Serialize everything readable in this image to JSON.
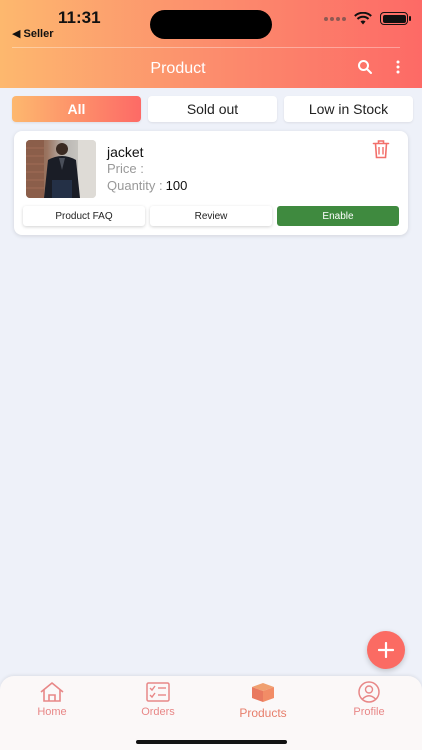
{
  "status": {
    "time": "11:31",
    "back_label": "◀ Seller"
  },
  "header": {
    "title": "Product"
  },
  "tabs": [
    {
      "label": "All",
      "active": true
    },
    {
      "label": "Sold out",
      "active": false
    },
    {
      "label": "Low in Stock",
      "active": false
    }
  ],
  "product": {
    "name": "jacket",
    "price_label": "Price :",
    "quantity_label": "Quantity :",
    "quantity_value": "100",
    "buttons": {
      "faq": "Product FAQ",
      "review": "Review",
      "enable": "Enable"
    }
  },
  "bottom_nav": [
    {
      "label": "Home",
      "icon": "home-icon"
    },
    {
      "label": "Orders",
      "icon": "orders-icon"
    },
    {
      "label": "Products",
      "icon": "products-icon",
      "active": true
    },
    {
      "label": "Profile",
      "icon": "profile-icon"
    }
  ],
  "colors": {
    "gradient_start": "#fdb86e",
    "gradient_end": "#fd6a66",
    "enable_green": "#3f8a3f",
    "fab": "#fb6b63",
    "nav_text": "#e88787"
  }
}
